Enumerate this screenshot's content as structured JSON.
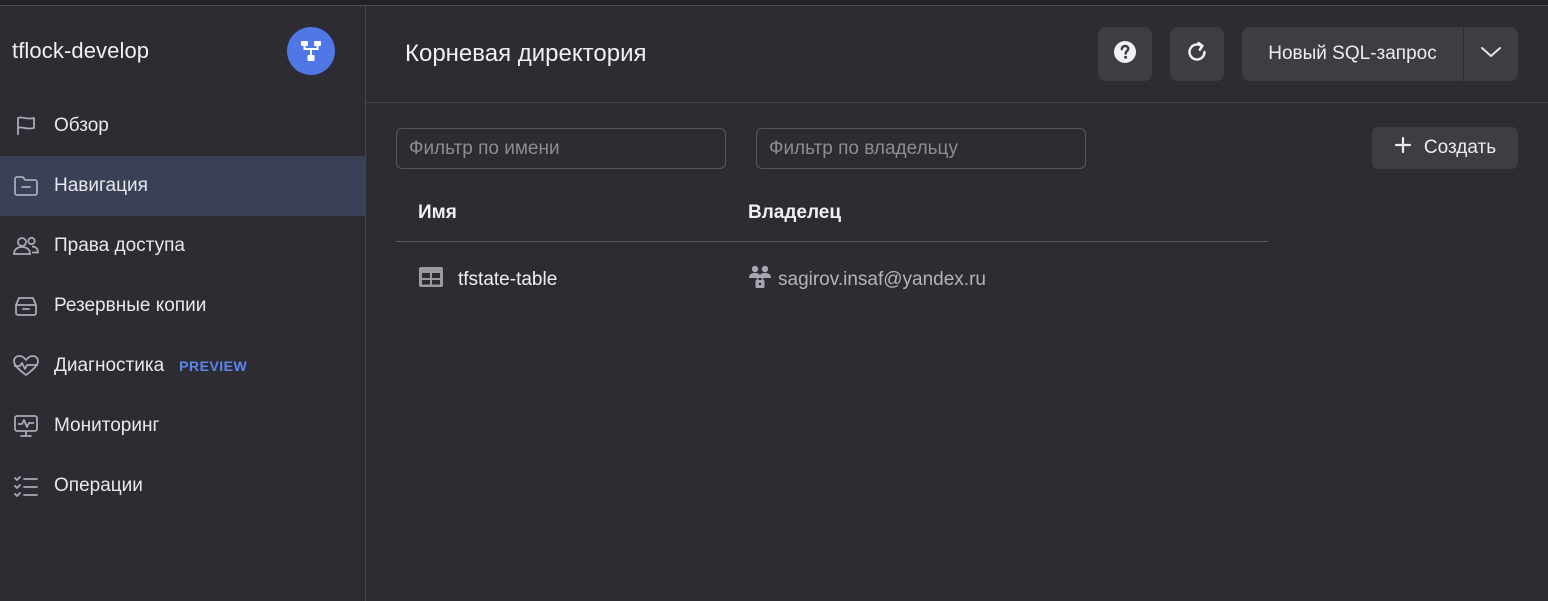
{
  "sidebar": {
    "title": "tflock-develop",
    "logo_icon": "database-tree-icon",
    "accent": "#5077e6",
    "items": [
      {
        "label": "Обзор",
        "icon": "flag-icon",
        "active": false
      },
      {
        "label": "Навигация",
        "icon": "folder-icon",
        "active": true
      },
      {
        "label": "Права доступа",
        "icon": "persons-icon",
        "active": false
      },
      {
        "label": "Резервные копии",
        "icon": "archive-icon",
        "active": false
      },
      {
        "label": "Диагностика",
        "icon": "heart-pulse-icon",
        "active": false,
        "badge": "PREVIEW"
      },
      {
        "label": "Мониторинг",
        "icon": "monitor-icon",
        "active": false
      },
      {
        "label": "Операции",
        "icon": "list-check-icon",
        "active": false
      }
    ]
  },
  "header": {
    "title": "Корневая директория",
    "help_icon": "help-circle-icon",
    "refresh_icon": "refresh-icon",
    "sql_button": "Новый SQL-запрос",
    "sql_dropdown_icon": "chevron-down-icon"
  },
  "filters": {
    "name_placeholder": "Фильтр по имени",
    "name_value": "",
    "owner_placeholder": "Фильтр по владельцу",
    "owner_value": ""
  },
  "create_button": "Создать",
  "table": {
    "columns": [
      "Имя",
      "Владелец"
    ],
    "rows": [
      {
        "name": "tfstate-table",
        "owner": "sagirov.insaf@yandex.ru",
        "name_icon": "table-icon",
        "owner_icon": "service-account-icon"
      }
    ]
  }
}
